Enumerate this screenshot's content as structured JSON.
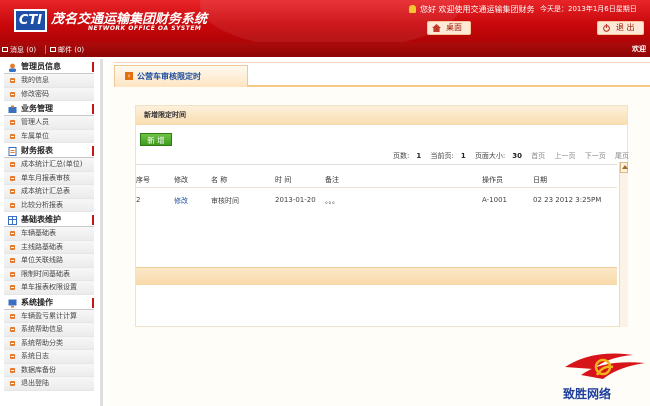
{
  "header": {
    "logo_text": "CTI",
    "title": "茂名交通运输集团财务系统",
    "subtitle": "NETWORK OFFICE OA SYSTEM",
    "user_greeting": "您好 欢迎使用交通运输集团财务",
    "date_text": "今天是：2013年1月6日星期日",
    "home_label": "桌面",
    "logout_label": "退 出"
  },
  "subbar": {
    "messages_label": "消息 (0)",
    "mail_label": "邮件 (0)",
    "welcome": "欢迎"
  },
  "sidebar": {
    "groups": [
      {
        "title": "管理员信息",
        "items": [
          "我的信息",
          "修改密码"
        ]
      },
      {
        "title": "业务管理",
        "items": [
          "管理人员",
          "车属单位"
        ]
      },
      {
        "title": "财务报表",
        "items": [
          "成本统计汇总(单位)",
          "单车月报表审核",
          "成本统计汇总表",
          "比较分析报表"
        ]
      },
      {
        "title": "基础表维护",
        "items": [
          "车辆基础表",
          "主线路基础表",
          "单位关联线路",
          "限制时间基础表",
          "单车报表权限设置"
        ]
      },
      {
        "title": "系统操作",
        "items": [
          "车辆盈亏累计计算",
          "系统帮助信息",
          "系统帮助分类",
          "系统日志",
          "数据库备份",
          "退出登陆"
        ]
      }
    ]
  },
  "main": {
    "page_title": "公营车审核限定时",
    "panel_title": "新增限定时间",
    "add_label": "新 增",
    "pager": {
      "total_pages_label": "页数:",
      "total_pages": "1",
      "current_page_label": "当前页:",
      "current_page": "1",
      "page_size_label": "页面大小:",
      "page_size": "30",
      "first": "首页",
      "prev": "上一页",
      "next": "下一页",
      "last": "尾页"
    },
    "table": {
      "headers": [
        "序号",
        "修改",
        "名 称",
        "时 间",
        "备注",
        "操作员",
        "日期"
      ],
      "rows": [
        {
          "no": "2",
          "edit": "修改",
          "name": "审核时间",
          "time": "2013-01-20",
          "note": "。。。",
          "operator": "A-1001",
          "date": "02 23 2012 3:25PM"
        }
      ]
    }
  },
  "brand": {
    "name": "致胜网络"
  },
  "colors": {
    "header_red": "#c8070b",
    "accent_orange": "#e2710d",
    "link_blue": "#1e4fa0",
    "add_green": "#4fa82c"
  }
}
